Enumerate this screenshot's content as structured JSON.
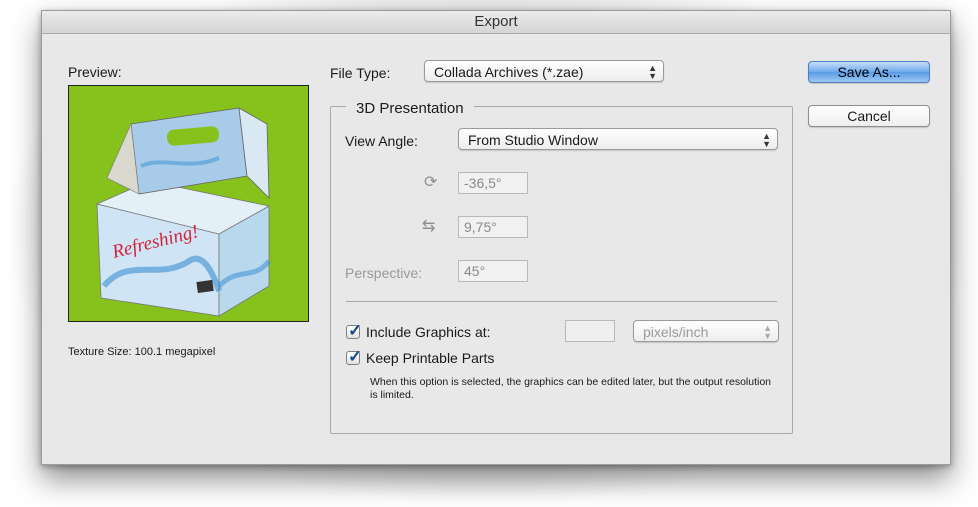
{
  "window": {
    "title": "Export"
  },
  "preview": {
    "label": "Preview:",
    "texture_size": "Texture Size: 100.1 megapixel",
    "box_text": "Refreshing!",
    "background_color": "#86c21b"
  },
  "file_type": {
    "label": "File Type:",
    "value": "Collada Archives (*.zae)"
  },
  "buttons": {
    "save_as": "Save As...",
    "cancel": "Cancel"
  },
  "presentation": {
    "title": "3D Presentation",
    "view_angle_label": "View Angle:",
    "view_angle_value": "From Studio Window",
    "rotation_y": "-36,5°",
    "rotation_x": "9,75°",
    "perspective_label": "Perspective:",
    "perspective_value": "45°"
  },
  "graphics": {
    "include_label": "Include Graphics at:",
    "include_checked": true,
    "resolution_value": "",
    "unit_value": "pixels/inch",
    "keep_label": "Keep Printable Parts",
    "keep_checked": true,
    "note": "When this option is selected, the graphics can be edited later, but the output resolution is limited."
  },
  "icons": {
    "rotate_vertical": "rotate-vertical-icon",
    "rotate_horizontal": "rotate-horizontal-icon",
    "popup_arrows": "up-down-arrows-icon",
    "checkmark": "checkmark-icon"
  },
  "colors": {
    "default_button": "#6fa9ec",
    "preview_background": "#86c21b"
  }
}
